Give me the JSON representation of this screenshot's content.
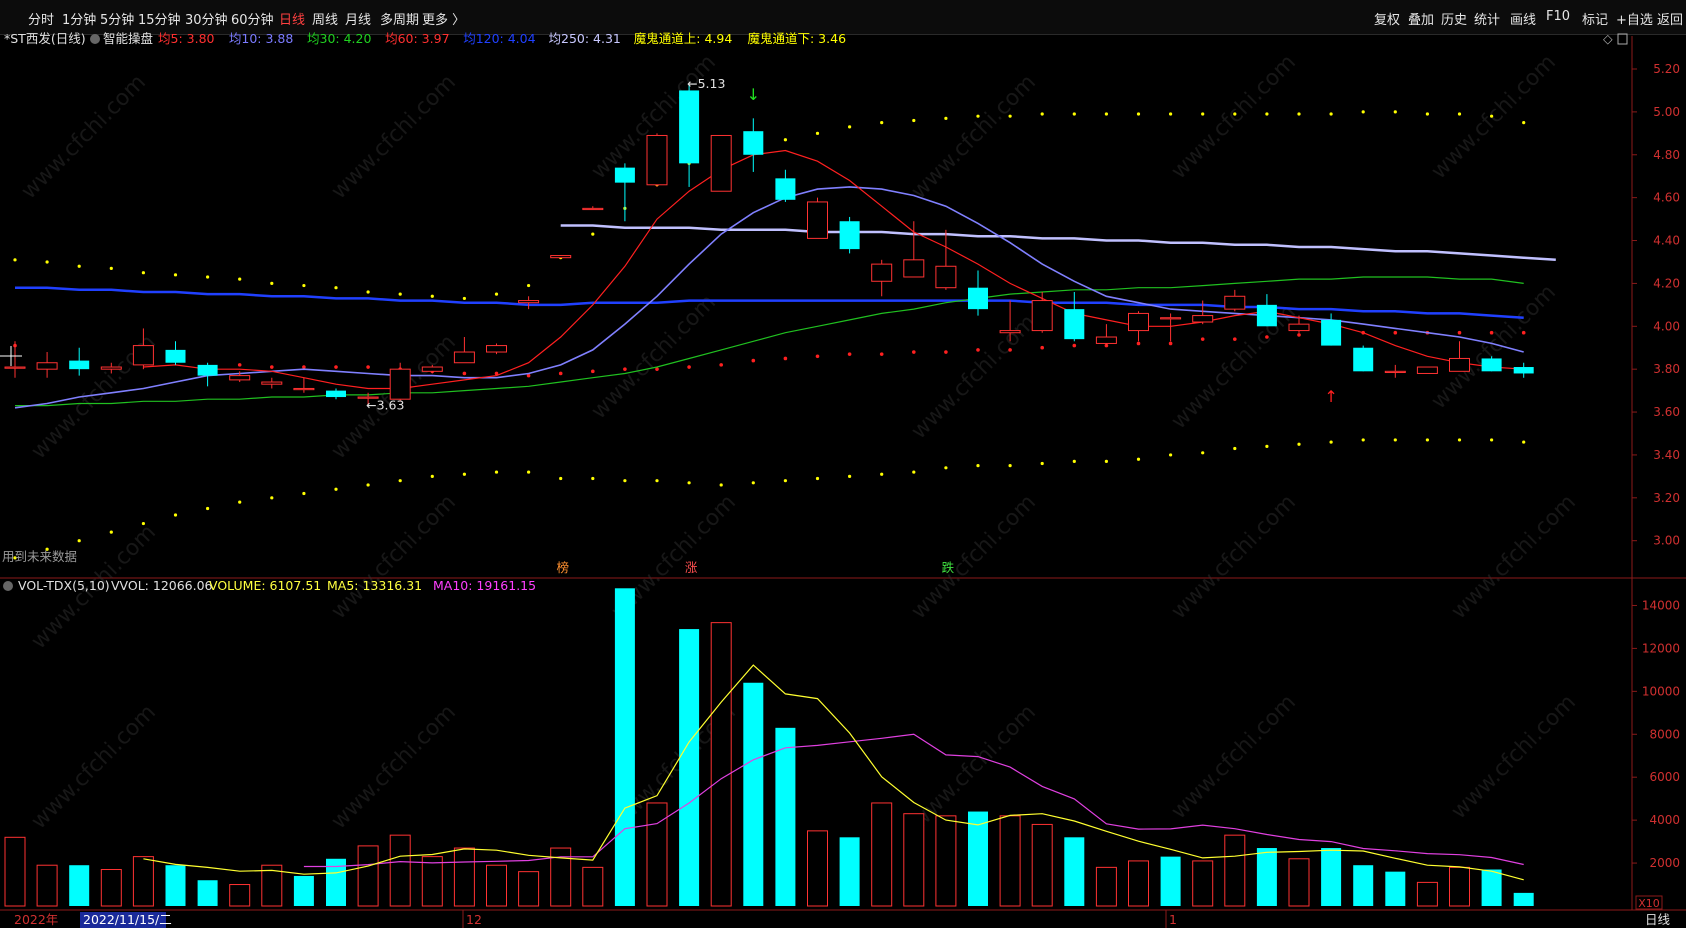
{
  "toolbar": {
    "left": [
      {
        "label": "分时",
        "active": false
      },
      {
        "label": "1分钟",
        "active": false
      },
      {
        "label": "5分钟",
        "active": false
      },
      {
        "label": "15分钟",
        "active": false
      },
      {
        "label": "30分钟",
        "active": false
      },
      {
        "label": "60分钟",
        "active": false
      },
      {
        "label": "日线",
        "active": true
      },
      {
        "label": "周线",
        "active": false
      },
      {
        "label": "月线",
        "active": false
      },
      {
        "label": "多周期",
        "active": false
      },
      {
        "label": "更多 〉",
        "active": false
      }
    ],
    "right": [
      "复权",
      "叠加",
      "历史",
      "统计",
      "画线",
      "F10",
      "标记",
      "+自选",
      "返回"
    ]
  },
  "main_panel": {
    "stock_label": "*ST西发(日线)",
    "indicator_name": "智能操盘",
    "legend": [
      {
        "text": "均5: 3.80",
        "color": "#ff3030"
      },
      {
        "text": "均10: 3.88",
        "color": "#7b7bff"
      },
      {
        "text": "均30: 4.20",
        "color": "#20d020"
      },
      {
        "text": "均60: 3.97",
        "color": "#ff3030"
      },
      {
        "text": "均120: 4.04",
        "color": "#2040ff"
      },
      {
        "text": "均250: 4.31",
        "color": "#c8c8ff"
      },
      {
        "text": "魔鬼通道上: 4.94",
        "color": "#ffff00"
      },
      {
        "text": "魔鬼通道下: 3.46",
        "color": "#ffff00"
      }
    ],
    "future_note": "用到未来数据",
    "high_marker": "5.13",
    "low_marker": "3.63",
    "signals": [
      {
        "text": "榜",
        "color": "#ff9030"
      },
      {
        "text": "涨",
        "color": "#ff5050"
      },
      {
        "text": "跌",
        "color": "#40e040"
      }
    ]
  },
  "volume_panel": {
    "legend": [
      {
        "text": "VOL-TDX(5,10)",
        "color": "#e0e0e0"
      },
      {
        "text": "VVOL: 12066.06",
        "color": "#e0e0e0"
      },
      {
        "text": "VOLUME: 6107.51",
        "color": "#ffff40"
      },
      {
        "text": "MA5: 13316.31",
        "color": "#ffff40"
      },
      {
        "text": "MA10: 19161.15",
        "color": "#ff40ff"
      }
    ],
    "unit_label": "X10"
  },
  "bottom_axis": {
    "year_label": "2022年",
    "cursor_date": "2022/11/15/二",
    "month_labels": [
      "12",
      "1"
    ],
    "period_label": "日线"
  },
  "watermark": "www.cfchi.com",
  "colors": {
    "up": "#ff3232",
    "down": "#00ffff",
    "ma5": "#ff2020",
    "ma10": "#8080ff",
    "ma30": "#20c020",
    "ma120": "#2040ff",
    "ma250": "#c0c0ff",
    "channel": "#ffff00"
  },
  "chart_data": [
    {
      "type": "candlestick",
      "title": "*ST西发(日线)",
      "y_ticks": [
        3.0,
        3.2,
        3.4,
        3.6,
        3.8,
        4.0,
        4.2,
        4.4,
        4.6,
        4.8,
        5.0,
        5.2
      ],
      "ylim": [
        2.84,
        5.27
      ],
      "candles": [
        {
          "o": 3.81,
          "h": 3.93,
          "l": 3.76,
          "c": 3.81
        },
        {
          "o": 3.8,
          "h": 3.88,
          "l": 3.76,
          "c": 3.83
        },
        {
          "o": 3.84,
          "h": 3.9,
          "l": 3.77,
          "c": 3.8
        },
        {
          "o": 3.8,
          "h": 3.83,
          "l": 3.78,
          "c": 3.81
        },
        {
          "o": 3.82,
          "h": 3.99,
          "l": 3.8,
          "c": 3.91
        },
        {
          "o": 3.89,
          "h": 3.93,
          "l": 3.82,
          "c": 3.83
        },
        {
          "o": 3.82,
          "h": 3.83,
          "l": 3.72,
          "c": 3.77
        },
        {
          "o": 3.75,
          "h": 3.79,
          "l": 3.74,
          "c": 3.77
        },
        {
          "o": 3.73,
          "h": 3.76,
          "l": 3.71,
          "c": 3.74
        },
        {
          "o": 3.71,
          "h": 3.76,
          "l": 3.69,
          "c": 3.71
        },
        {
          "o": 3.7,
          "h": 3.71,
          "l": 3.66,
          "c": 3.67
        },
        {
          "o": 3.67,
          "h": 3.69,
          "l": 3.63,
          "c": 3.67
        },
        {
          "o": 3.66,
          "h": 3.83,
          "l": 3.65,
          "c": 3.8
        },
        {
          "o": 3.79,
          "h": 3.82,
          "l": 3.78,
          "c": 3.81
        },
        {
          "o": 3.83,
          "h": 3.95,
          "l": 3.83,
          "c": 3.88
        },
        {
          "o": 3.88,
          "h": 3.92,
          "l": 3.87,
          "c": 3.91
        },
        {
          "o": 4.11,
          "h": 4.14,
          "l": 4.08,
          "c": 4.12
        },
        {
          "o": 4.32,
          "h": 4.33,
          "l": 4.32,
          "c": 4.33
        },
        {
          "o": 4.55,
          "h": 4.56,
          "l": 4.55,
          "c": 4.55
        },
        {
          "o": 4.74,
          "h": 4.76,
          "l": 4.49,
          "c": 4.67
        },
        {
          "o": 4.66,
          "h": 4.9,
          "l": 4.65,
          "c": 4.89
        },
        {
          "o": 5.1,
          "h": 5.13,
          "l": 4.65,
          "c": 4.76
        },
        {
          "o": 4.63,
          "h": 4.89,
          "l": 4.63,
          "c": 4.89
        },
        {
          "o": 4.91,
          "h": 4.97,
          "l": 4.72,
          "c": 4.8
        },
        {
          "o": 4.69,
          "h": 4.73,
          "l": 4.58,
          "c": 4.59
        },
        {
          "o": 4.41,
          "h": 4.6,
          "l": 4.41,
          "c": 4.58
        },
        {
          "o": 4.49,
          "h": 4.51,
          "l": 4.34,
          "c": 4.36
        },
        {
          "o": 4.21,
          "h": 4.31,
          "l": 4.14,
          "c": 4.29
        },
        {
          "o": 4.23,
          "h": 4.49,
          "l": 4.23,
          "c": 4.31
        },
        {
          "o": 4.18,
          "h": 4.45,
          "l": 4.17,
          "c": 4.28
        },
        {
          "o": 4.18,
          "h": 4.26,
          "l": 4.05,
          "c": 4.08
        },
        {
          "o": 3.97,
          "h": 4.12,
          "l": 3.93,
          "c": 3.98
        },
        {
          "o": 3.98,
          "h": 4.16,
          "l": 3.97,
          "c": 4.12
        },
        {
          "o": 4.08,
          "h": 4.16,
          "l": 3.93,
          "c": 3.94
        },
        {
          "o": 3.92,
          "h": 4.01,
          "l": 3.91,
          "c": 3.95
        },
        {
          "o": 3.98,
          "h": 4.07,
          "l": 3.93,
          "c": 4.06
        },
        {
          "o": 4.04,
          "h": 4.06,
          "l": 3.93,
          "c": 4.04
        },
        {
          "o": 4.02,
          "h": 4.12,
          "l": 4.01,
          "c": 4.05
        },
        {
          "o": 4.08,
          "h": 4.17,
          "l": 4.07,
          "c": 4.14
        },
        {
          "o": 4.1,
          "h": 4.15,
          "l": 4.0,
          "c": 4.0
        },
        {
          "o": 3.98,
          "h": 4.05,
          "l": 3.97,
          "c": 4.01
        },
        {
          "o": 4.03,
          "h": 4.06,
          "l": 3.91,
          "c": 3.91
        },
        {
          "o": 3.9,
          "h": 3.91,
          "l": 3.79,
          "c": 3.79
        },
        {
          "o": 3.79,
          "h": 3.82,
          "l": 3.76,
          "c": 3.79
        },
        {
          "o": 3.78,
          "h": 3.81,
          "l": 3.78,
          "c": 3.81
        },
        {
          "o": 3.79,
          "h": 3.93,
          "l": 3.79,
          "c": 3.85
        },
        {
          "o": 3.85,
          "h": 3.86,
          "l": 3.79,
          "c": 3.79
        },
        {
          "o": 3.81,
          "h": 3.83,
          "l": 3.76,
          "c": 3.78
        }
      ],
      "ma5": [
        null,
        null,
        null,
        null,
        3.81,
        3.82,
        3.8,
        3.8,
        3.79,
        3.76,
        3.73,
        3.71,
        3.71,
        3.73,
        3.75,
        3.77,
        3.83,
        3.95,
        4.1,
        4.28,
        4.5,
        4.63,
        4.73,
        4.8,
        4.82,
        4.77,
        4.68,
        4.56,
        4.44,
        4.37,
        4.29,
        4.2,
        4.13,
        4.06,
        4.03,
        4.0,
        4.0,
        4.02,
        4.05,
        4.07,
        4.04,
        4.01,
        3.97,
        3.91,
        3.86,
        3.83,
        3.81,
        3.8
      ],
      "ma10": [
        3.62,
        3.64,
        3.67,
        3.69,
        3.71,
        3.74,
        3.77,
        3.78,
        3.79,
        3.8,
        3.79,
        3.78,
        3.77,
        3.77,
        3.76,
        3.76,
        3.78,
        3.82,
        3.89,
        4.01,
        4.14,
        4.29,
        4.43,
        4.53,
        4.6,
        4.64,
        4.65,
        4.64,
        4.61,
        4.56,
        4.48,
        4.39,
        4.29,
        4.21,
        4.14,
        4.11,
        4.08,
        4.07,
        4.06,
        4.05,
        4.04,
        4.03,
        4.01,
        3.99,
        3.97,
        3.95,
        3.92,
        3.88
      ],
      "ma30": [
        3.63,
        3.63,
        3.64,
        3.64,
        3.65,
        3.65,
        3.66,
        3.66,
        3.67,
        3.67,
        3.68,
        3.68,
        3.69,
        3.69,
        3.7,
        3.71,
        3.72,
        3.74,
        3.76,
        3.78,
        3.81,
        3.85,
        3.89,
        3.93,
        3.97,
        4.0,
        4.03,
        4.06,
        4.08,
        4.11,
        4.13,
        4.15,
        4.16,
        4.17,
        4.17,
        4.18,
        4.18,
        4.19,
        4.2,
        4.21,
        4.22,
        4.22,
        4.23,
        4.23,
        4.23,
        4.22,
        4.22,
        4.2
      ],
      "ma120": [
        4.18,
        4.18,
        4.17,
        4.17,
        4.16,
        4.16,
        4.15,
        4.15,
        4.14,
        4.14,
        4.13,
        4.13,
        4.12,
        4.12,
        4.11,
        4.11,
        4.1,
        4.1,
        4.11,
        4.11,
        4.11,
        4.12,
        4.12,
        4.12,
        4.12,
        4.12,
        4.12,
        4.12,
        4.12,
        4.12,
        4.12,
        4.12,
        4.11,
        4.11,
        4.11,
        4.1,
        4.1,
        4.1,
        4.09,
        4.09,
        4.08,
        4.08,
        4.07,
        4.07,
        4.06,
        4.06,
        4.05,
        4.04
      ],
      "ma250_start": 17,
      "ma250": [
        4.47,
        4.47,
        4.46,
        4.46,
        4.46,
        4.45,
        4.45,
        4.45,
        4.44,
        4.44,
        4.44,
        4.43,
        4.43,
        4.42,
        4.42,
        4.41,
        4.41,
        4.4,
        4.4,
        4.39,
        4.39,
        4.38,
        4.38,
        4.37,
        4.37,
        4.36,
        4.35,
        4.35,
        4.34,
        4.33,
        4.32,
        4.31
      ],
      "channel_upper": [
        4.31,
        4.3,
        4.28,
        4.27,
        4.25,
        4.24,
        4.23,
        4.22,
        4.2,
        4.19,
        4.18,
        4.16,
        4.15,
        4.14,
        4.13,
        4.15,
        4.19,
        4.32,
        4.43,
        4.55,
        4.66,
        4.76,
        4.81,
        4.84,
        4.87,
        4.9,
        4.93,
        4.95,
        4.96,
        4.97,
        4.98,
        4.98,
        4.99,
        4.99,
        4.99,
        4.99,
        4.99,
        4.99,
        4.99,
        4.99,
        4.99,
        4.99,
        5.0,
        5.0,
        4.99,
        4.99,
        4.98,
        4.95
      ],
      "channel_lower": [
        2.92,
        2.96,
        3.0,
        3.04,
        3.08,
        3.12,
        3.15,
        3.18,
        3.2,
        3.22,
        3.24,
        3.26,
        3.28,
        3.3,
        3.31,
        3.32,
        3.32,
        3.29,
        3.29,
        3.28,
        3.28,
        3.27,
        3.26,
        3.27,
        3.28,
        3.29,
        3.3,
        3.31,
        3.32,
        3.34,
        3.35,
        3.35,
        3.36,
        3.37,
        3.37,
        3.38,
        3.4,
        3.41,
        3.43,
        3.44,
        3.45,
        3.46,
        3.47,
        3.47,
        3.47,
        3.47,
        3.47,
        3.46
      ],
      "red_dots": [
        3.91,
        null,
        null,
        null,
        null,
        null,
        null,
        3.82,
        3.81,
        3.81,
        3.81,
        3.81,
        3.8,
        3.79,
        3.78,
        3.78,
        3.77,
        3.78,
        3.79,
        3.8,
        3.8,
        3.81,
        3.82,
        3.84,
        3.85,
        3.86,
        3.87,
        3.87,
        3.88,
        3.88,
        3.89,
        3.89,
        3.9,
        3.91,
        3.91,
        3.92,
        3.92,
        3.94,
        3.94,
        3.95,
        3.96,
        3.96,
        3.97,
        3.97,
        3.97,
        3.97,
        3.97,
        3.97
      ]
    },
    {
      "type": "bar",
      "title": "VOL-TDX(5,10)",
      "y_ticks": [
        2000,
        4000,
        6000,
        8000,
        10000,
        12000,
        14000
      ],
      "ylim": [
        0,
        15000
      ],
      "volume": [
        3200,
        1900,
        1900,
        1700,
        2300,
        1900,
        1200,
        1000,
        1900,
        1400,
        2200,
        2800,
        3300,
        2300,
        2700,
        1900,
        1600,
        2700,
        1800,
        14800,
        4800,
        12900,
        13200,
        10400,
        8300,
        3500,
        3200,
        4800,
        4300,
        4200,
        4400,
        4200,
        3800,
        3200,
        1800,
        2100,
        2300,
        2100,
        3300,
        2700,
        2200,
        2700,
        1900,
        1600,
        1100,
        1800,
        1700,
        611
      ],
      "volume_up": [
        true,
        true,
        false,
        true,
        true,
        false,
        false,
        true,
        true,
        false,
        false,
        true,
        true,
        true,
        true,
        true,
        true,
        true,
        true,
        false,
        true,
        false,
        true,
        false,
        false,
        true,
        false,
        true,
        true,
        true,
        false,
        true,
        true,
        false,
        true,
        true,
        false,
        true,
        true,
        false,
        true,
        false,
        false,
        false,
        true,
        true,
        false,
        false
      ],
      "ma5": [
        null,
        null,
        null,
        null,
        2200,
        1940,
        1800,
        1620,
        1660,
        1480,
        1540,
        1860,
        2320,
        2400,
        2660,
        2600,
        2360,
        2240,
        2140,
        4560,
        5140,
        7640,
        9500,
        11220,
        9880,
        9660,
        8060,
        6020,
        4820,
        4000,
        3780,
        4220,
        4300,
        3960,
        3480,
        3020,
        2640,
        2240,
        2320,
        2500,
        2540,
        2600,
        2560,
        2220,
        1900,
        1820,
        1620,
        1221
      ],
      "ma10": [
        null,
        null,
        null,
        null,
        null,
        null,
        null,
        null,
        null,
        1840,
        1840,
        1930,
        2070,
        2010,
        2050,
        2080,
        2120,
        2290,
        2290,
        3600,
        3840,
        4800,
        5930,
        6810,
        7370,
        7480,
        7650,
        7810,
        8000,
        7040,
        6960,
        6470,
        5570,
        4990,
        3830,
        3580,
        3590,
        3770,
        3600,
        3330,
        3100,
        3000,
        2680,
        2570,
        2440,
        2390,
        2260,
        1931
      ]
    }
  ]
}
